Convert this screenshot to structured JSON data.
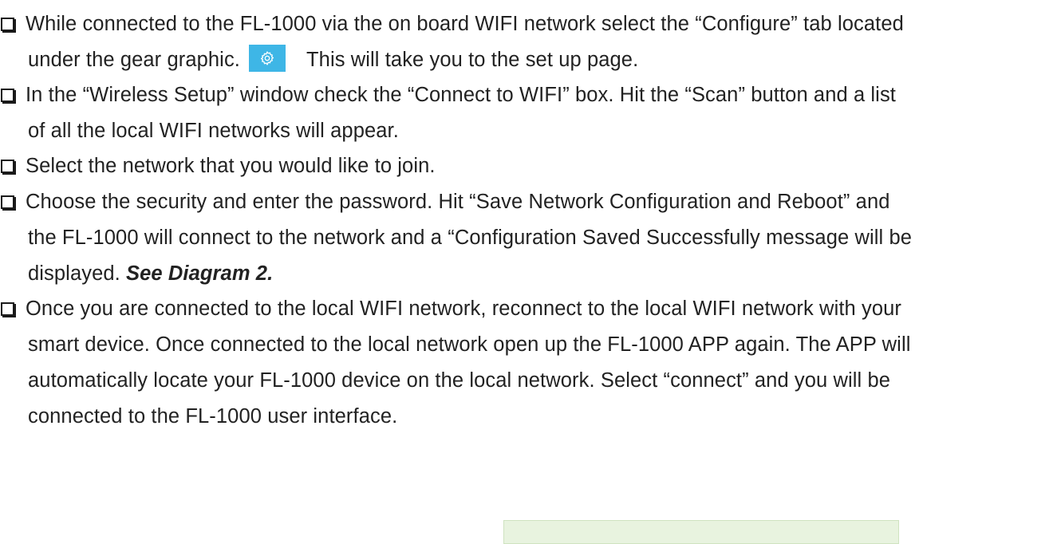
{
  "instructions": [
    {
      "lines": [
        "While connected to the FL-1000 via the on board WIFI network select the “Configure” tab located",
        "under the gear graphic."
      ],
      "after_icon": "This will take you to the set up page.",
      "icon": "gear-icon",
      "icon_color": "#3eb6e6"
    },
    {
      "lines": [
        "In the  “Wireless Setup” window check the “Connect to WIFI” box. Hit the “Scan” button and a list",
        "of all the local WIFI networks will appear."
      ]
    },
    {
      "lines": [
        "Select the network that you would like to join."
      ]
    },
    {
      "lines": [
        "Choose the security and enter the password. Hit “Save Network Configuration and Reboot” and",
        "the FL-1000 will connect to the network and a “Configuration Saved Successfully message will be",
        "displayed."
      ],
      "emphasis": "See Diagram 2."
    },
    {
      "lines": [
        "Once you are connected to the local WIFI network, reconnect to the local WIFI network with your",
        "smart device. Once connected to the local network open up the FL-1000 APP again. The APP will",
        "automatically locate your FL-1000 device on the local network. Select “connect” and you will be",
        "connected to the FL-1000 user interface."
      ]
    }
  ],
  "colors": {
    "gear_button": "#3eb6e6",
    "panel_fill": "#e8f3df"
  }
}
